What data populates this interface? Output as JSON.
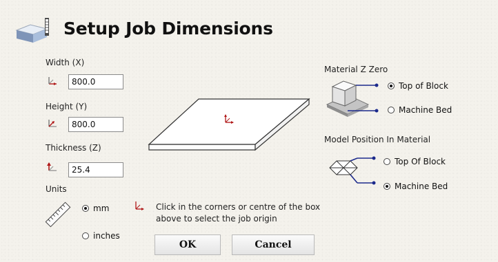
{
  "dialog": {
    "title": "Setup Job Dimensions"
  },
  "width": {
    "label": "Width (X)",
    "value": "800.0"
  },
  "height": {
    "label": "Height (Y)",
    "value": "800.0"
  },
  "thickness": {
    "label": "Thickness (Z)",
    "value": "25.4"
  },
  "units": {
    "label": "Units",
    "options": [
      {
        "label": "mm",
        "checked": true
      },
      {
        "label": "inches",
        "checked": false
      }
    ]
  },
  "origin": {
    "hint_line1": "Click in the corners or centre of the box",
    "hint_line2": "above to select the job origin"
  },
  "material_z_zero": {
    "label": "Material Z Zero",
    "options": [
      {
        "label": "Top of Block",
        "checked": true
      },
      {
        "label": "Machine Bed",
        "checked": false
      }
    ]
  },
  "model_position": {
    "label": "Model Position In Material",
    "options": [
      {
        "label": "Top Of Block",
        "checked": false
      },
      {
        "label": "Machine Bed",
        "checked": true
      }
    ]
  },
  "buttons": {
    "ok": "OK",
    "cancel": "Cancel"
  },
  "colors": {
    "accent_blue": "#1c2a8c",
    "axis_red": "#b01818"
  },
  "icons": {
    "header": "block-setup-icon",
    "axis": "axis-origin-icon",
    "ruler": "ruler-icon"
  }
}
